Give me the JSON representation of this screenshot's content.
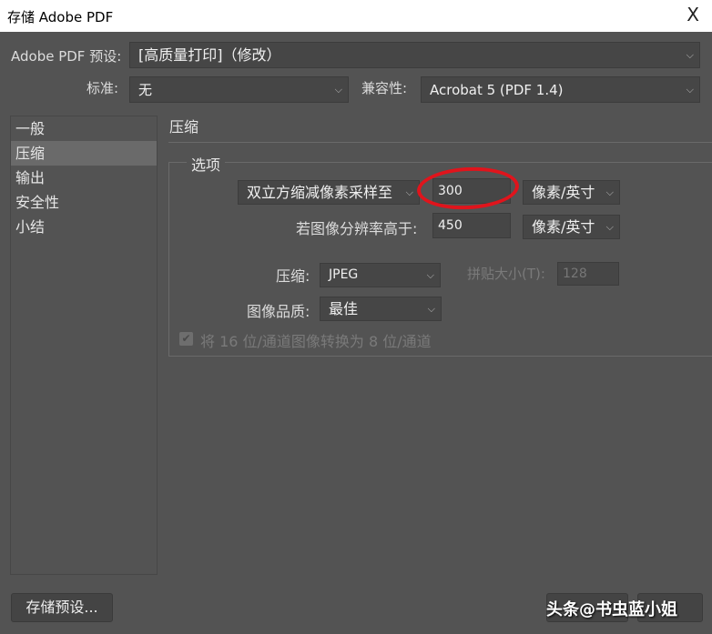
{
  "window": {
    "title": "存储 Adobe PDF",
    "close": "X"
  },
  "preset": {
    "label": "Adobe PDF 预设:",
    "value": "[高质量打印]（修改）"
  },
  "standard": {
    "label": "标准:",
    "value": "无"
  },
  "compat": {
    "label": "兼容性:",
    "value": "Acrobat 5 (PDF 1.4)"
  },
  "sidebar": {
    "items": [
      {
        "label": "一般"
      },
      {
        "label": "压缩"
      },
      {
        "label": "输出"
      },
      {
        "label": "安全性"
      },
      {
        "label": "小结"
      }
    ]
  },
  "section": {
    "title": "压缩",
    "group": "选项"
  },
  "sampling": {
    "method": "双立方缩减像素采样至",
    "value": "300",
    "unit": "像素/英寸",
    "above_label": "若图像分辨率高于:",
    "above_value": "450",
    "above_unit": "像素/英寸"
  },
  "compression": {
    "label": "压缩:",
    "value": "JPEG",
    "tile_label": "拼贴大小(T):",
    "tile_value": "128"
  },
  "quality": {
    "label": "图像品质:",
    "value": "最佳"
  },
  "convert": {
    "label": "将 16 位/通道图像转换为 8 位/通道",
    "checked": true
  },
  "footer": {
    "save_preset": "存储预设...",
    "watermark": "头条@书虫蓝小姐"
  },
  "colors": {
    "bg": "#535353",
    "highlight": "#e0141c"
  }
}
